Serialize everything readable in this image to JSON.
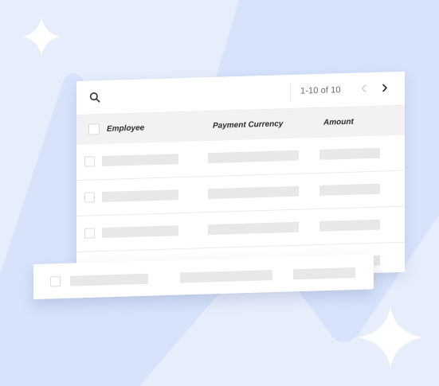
{
  "colors": {
    "background": "#e6eefc",
    "accent_shape": "#d5e2fb",
    "sparkle": "#ffffff",
    "card": "#ffffff",
    "header_row": "#f2f2f2",
    "placeholder_bar": "#e8e8e8"
  },
  "toolbar": {
    "search_icon": "search-icon",
    "pagination_text": "1-10 of 10",
    "prev_icon": "chevron-left-icon",
    "next_icon": "chevron-right-icon"
  },
  "table": {
    "columns": [
      "Employee",
      "Payment Currency",
      "Amount"
    ],
    "placeholder_rows": 4
  },
  "decorations": [
    "sparkle-icon",
    "sparkle-icon"
  ]
}
